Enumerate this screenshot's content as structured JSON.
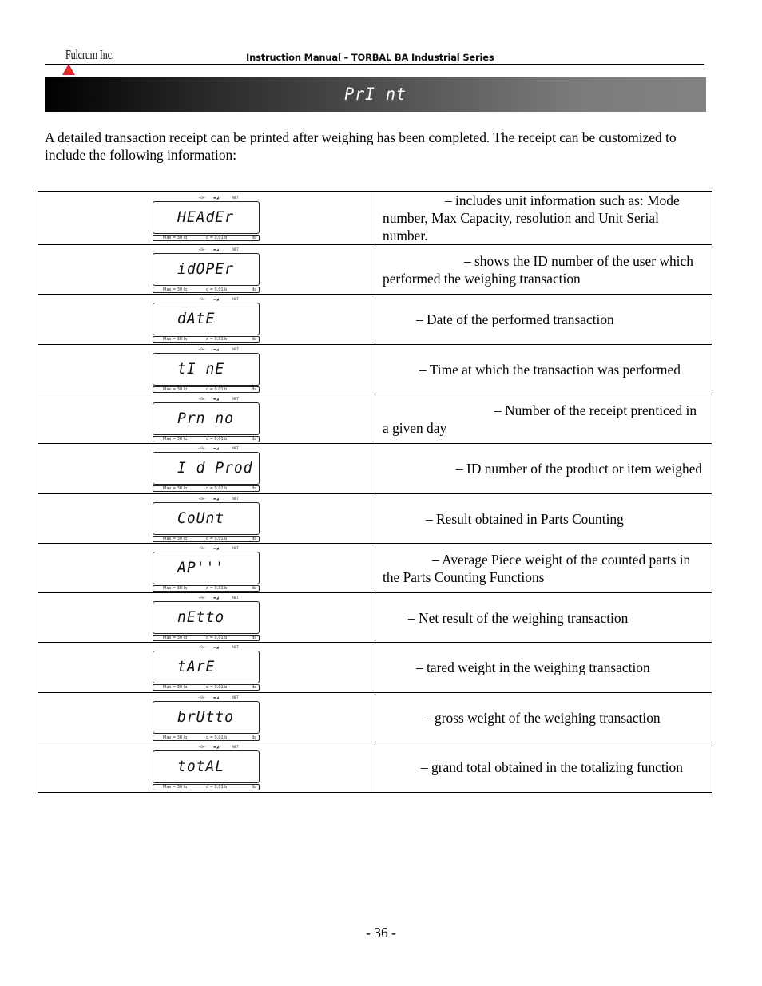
{
  "header": {
    "logo": "Fulcrum Inc.",
    "manual_title": "Instruction Manual – TORBAL BA Industrial Series",
    "accent_color": "#e8262d"
  },
  "banner": {
    "title": "PrI nt"
  },
  "intro": "A detailed transaction receipt can be printed after weighing has been completed. The receipt can be customized to include the following information:",
  "lcd_common": {
    "zero_indicator": "→0←",
    "stable_indicator": "▬◢",
    "net_indicator": "NET",
    "max_label": "Max = 30 lb",
    "division_label": "d = 0,01lb",
    "unit_label": "lb"
  },
  "rows": [
    {
      "display": "HEAdEr",
      "description": "– includes unit information such as: Mode number, Max Capacity, resolution and Unit Serial number."
    },
    {
      "display": "idOPEr",
      "description": "– shows the ID number of the user which performed the weighing transaction"
    },
    {
      "display": "dAtE",
      "description": "– Date of the performed transaction"
    },
    {
      "display": "tI nE",
      "description": "– Time at which the transaction was performed"
    },
    {
      "display": "Prn no",
      "description": "– Number of the receipt prenticed in a given day"
    },
    {
      "display": "I d Prod",
      "description": "– ID number of the product or item weighed"
    },
    {
      "display": "CoUnt",
      "description": "– Result obtained in Parts Counting"
    },
    {
      "display": "AP'''",
      "description": "– Average Piece weight of the counted parts in the Parts Counting Functions"
    },
    {
      "display": "nEtto",
      "description": "– Net result of the weighing transaction"
    },
    {
      "display": "tArE",
      "description": "– tared weight in the weighing transaction"
    },
    {
      "display": "brUtto",
      "description": "– gross weight of the weighing transaction"
    },
    {
      "display": "totAL",
      "description": "– grand total obtained in the totalizing function"
    }
  ],
  "footer": {
    "page_number": "- 36 -"
  }
}
